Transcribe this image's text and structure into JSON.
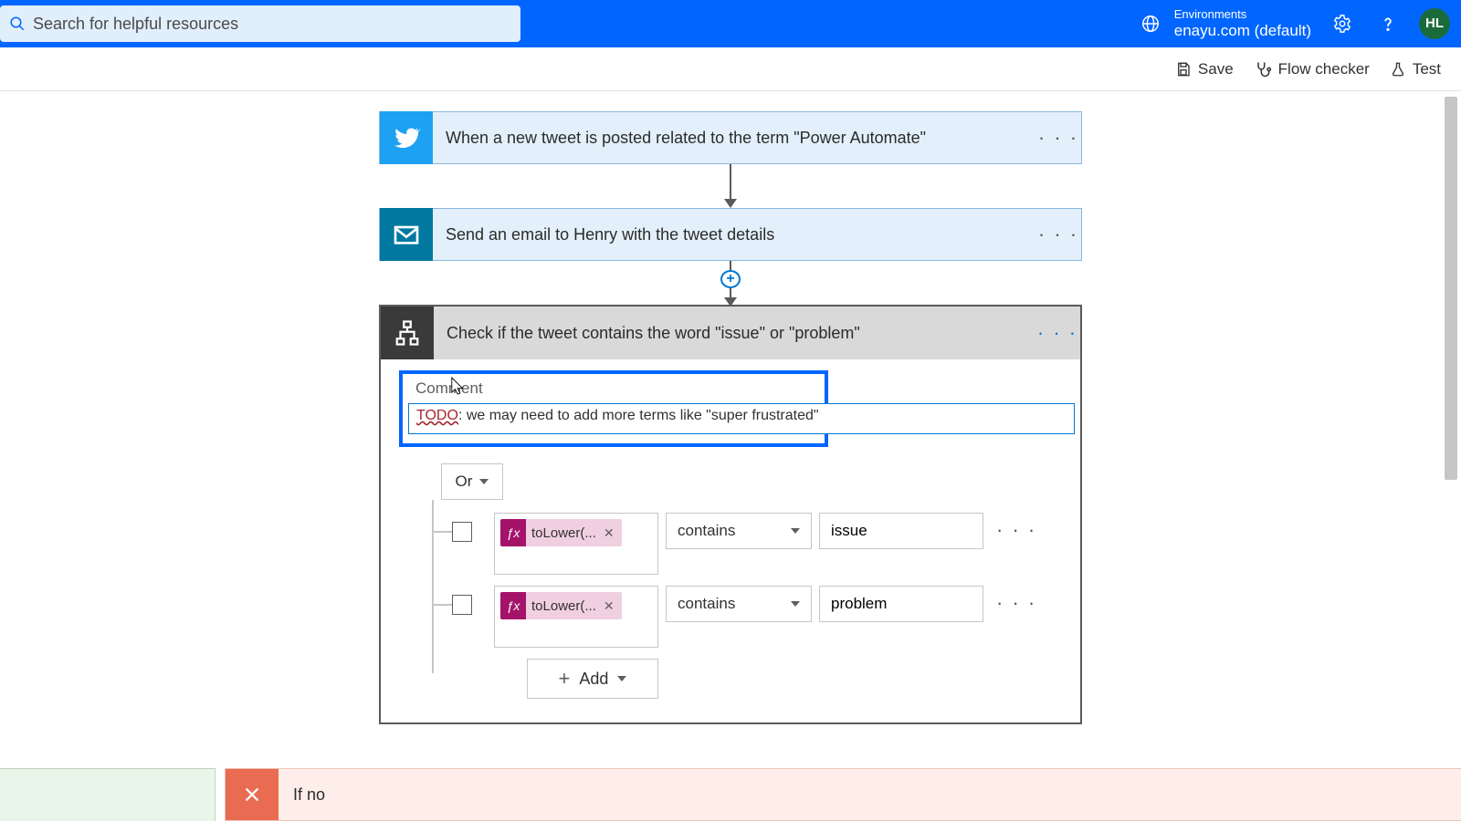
{
  "search": {
    "placeholder": "Search for helpful resources"
  },
  "environments": {
    "label": "Environments",
    "value": "enayu.com (default)"
  },
  "avatar": "HL",
  "toolbar": {
    "save": "Save",
    "flow_checker": "Flow checker",
    "test": "Test"
  },
  "flow": {
    "trigger": {
      "title": "When a new tweet is posted related to the term \"Power Automate\""
    },
    "action1": {
      "title": "Send an email to Henry with the tweet details"
    },
    "condition": {
      "title": "Check if the tweet contains the word \"issue\" or \"problem\"",
      "comment_label": "Comment",
      "comment_todo": "TODO",
      "comment_rest": ": we may need to add more terms like \"super frustrated\"",
      "logic": "Or",
      "rows": [
        {
          "token": "toLower(...",
          "operator": "contains",
          "value": "issue"
        },
        {
          "token": "toLower(...",
          "operator": "contains",
          "value": "problem"
        }
      ],
      "add": "Add"
    },
    "if_no": "If no"
  }
}
